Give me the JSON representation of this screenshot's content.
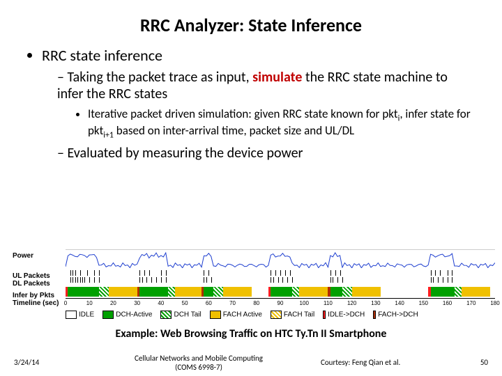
{
  "title": "RRC Analyzer: State Inference",
  "bullets": {
    "l1": "RRC state inference",
    "l2a_pre": "Taking the packet trace as input, ",
    "l2a_hl": "simulate",
    "l2a_post": " the RRC state machine to infer the RRC states",
    "l3a": "Iterative packet driven simulation: given RRC state known for pkt",
    "l3a_sub1": "i",
    "l3a_mid": ", infer state for pkt",
    "l3a_sub2": "i+1",
    "l3a_post": " based on inter-arrival time, packet size and UL/DL",
    "l2b": "Evaluated by measuring the device power"
  },
  "figure": {
    "ylabels": {
      "power": "Power",
      "ul": "UL Packets",
      "dl": "DL Packets",
      "infer1": "Infer by Pkts",
      "infer2": "Timeline (sec)"
    },
    "legend": {
      "idle": "IDLE",
      "dch": "DCH-Active",
      "dchtail": "DCH Tail",
      "fach": "FACH Active",
      "fachtail": "FACH Tail",
      "idledch": "IDLE->DCH",
      "fachdch": "FACH->DCH"
    }
  },
  "caption": "Example: Web Browsing Traffic on HTC Ty.Tn II Smartphone",
  "footer": {
    "date": "3/24/14",
    "mid1": "Cellular Networks and Mobile Computing",
    "mid2": "(COMS 6998-7)",
    "credit": "Courtesy: Feng Qian et al.",
    "page": "50"
  },
  "chart_data": {
    "type": "other",
    "title": "RRC state inference timeline (power trace, UL/DL packet ticks, inferred RRC state bar)",
    "xlabel": "Timeline (sec)",
    "x_ticks": [
      0,
      10,
      20,
      30,
      40,
      50,
      60,
      70,
      80,
      90,
      100,
      110,
      120,
      130,
      140,
      150,
      160,
      170,
      180
    ],
    "xlim": [
      0,
      180
    ],
    "tracks": [
      {
        "name": "Power",
        "type": "line",
        "ylabel": "Power",
        "note": "qualitative noisy power trace, bursts correlate with DCH-Active segments"
      },
      {
        "name": "UL Packets",
        "type": "rug"
      },
      {
        "name": "DL Packets",
        "type": "rug"
      },
      {
        "name": "Infer by Pkts",
        "type": "state-bar",
        "states": [
          "IDLE",
          "DCH-Active",
          "DCH Tail",
          "FACH Active",
          "FACH Tail",
          "IDLE->DCH",
          "FACH->DCH"
        ]
      }
    ],
    "state_segments": [
      {
        "state": "IDLE->DCH",
        "start": 0,
        "end": 1
      },
      {
        "state": "DCH-Active",
        "start": 1,
        "end": 14
      },
      {
        "state": "DCH Tail",
        "start": 14,
        "end": 18
      },
      {
        "state": "FACH Active",
        "start": 18,
        "end": 30
      },
      {
        "state": "FACH->DCH",
        "start": 30,
        "end": 31
      },
      {
        "state": "DCH-Active",
        "start": 31,
        "end": 43
      },
      {
        "state": "DCH Tail",
        "start": 43,
        "end": 46
      },
      {
        "state": "FACH Active",
        "start": 46,
        "end": 57
      },
      {
        "state": "FACH->DCH",
        "start": 57,
        "end": 58
      },
      {
        "state": "DCH-Active",
        "start": 58,
        "end": 62
      },
      {
        "state": "DCH Tail",
        "start": 62,
        "end": 66
      },
      {
        "state": "FACH Active",
        "start": 66,
        "end": 78
      },
      {
        "state": "IDLE",
        "start": 78,
        "end": 85
      },
      {
        "state": "IDLE->DCH",
        "start": 85,
        "end": 86
      },
      {
        "state": "DCH-Active",
        "start": 86,
        "end": 95
      },
      {
        "state": "DCH Tail",
        "start": 95,
        "end": 98
      },
      {
        "state": "FACH Active",
        "start": 98,
        "end": 110
      },
      {
        "state": "FACH->DCH",
        "start": 110,
        "end": 111
      },
      {
        "state": "DCH-Active",
        "start": 111,
        "end": 116
      },
      {
        "state": "DCH Tail",
        "start": 116,
        "end": 120
      },
      {
        "state": "FACH Active",
        "start": 120,
        "end": 132
      },
      {
        "state": "IDLE",
        "start": 132,
        "end": 152
      },
      {
        "state": "IDLE->DCH",
        "start": 152,
        "end": 153
      },
      {
        "state": "DCH-Active",
        "start": 153,
        "end": 163
      },
      {
        "state": "DCH Tail",
        "start": 163,
        "end": 166
      },
      {
        "state": "FACH Active",
        "start": 166,
        "end": 178
      },
      {
        "state": "IDLE",
        "start": 178,
        "end": 180
      }
    ],
    "ul_packet_times": [
      2,
      3,
      4,
      6,
      9,
      12,
      14,
      31,
      33,
      35,
      40,
      42,
      58,
      60,
      86,
      88,
      90,
      92,
      94,
      111,
      113,
      115,
      153,
      155,
      157,
      160,
      162
    ],
    "dl_packet_times": [
      2,
      3,
      4,
      5,
      6,
      7,
      8,
      10,
      12,
      14,
      31,
      32,
      34,
      36,
      38,
      40,
      42,
      58,
      59,
      61,
      86,
      87,
      89,
      91,
      93,
      95,
      111,
      112,
      114,
      116,
      153,
      154,
      156,
      158,
      160,
      162
    ]
  }
}
